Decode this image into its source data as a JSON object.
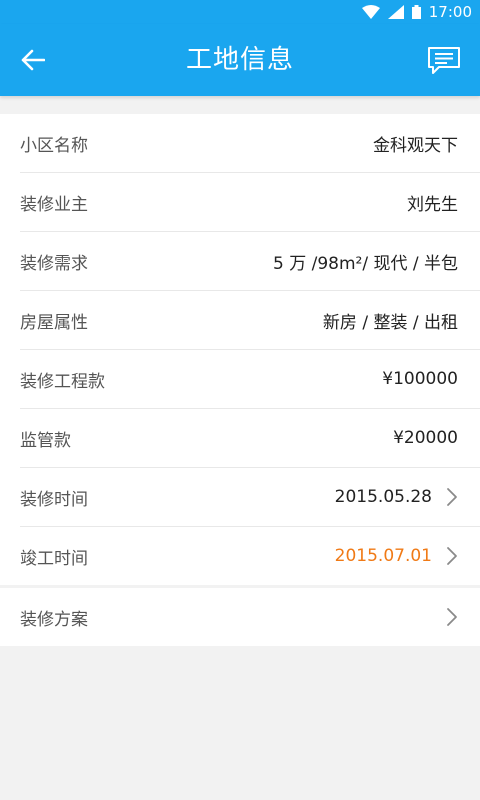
{
  "status": {
    "time": "17:00"
  },
  "appbar": {
    "title": "工地信息"
  },
  "rows": [
    {
      "label": "小区名称",
      "value": "金科观天下"
    },
    {
      "label": "装修业主",
      "value": "刘先生"
    },
    {
      "label": "装修需求",
      "value": "5 万 /98m²/ 现代 / 半包"
    },
    {
      "label": "房屋属性",
      "value": "新房 / 整装 / 出租"
    },
    {
      "label": "装修工程款",
      "value": "¥100000"
    },
    {
      "label": "监管款",
      "value": "¥20000"
    },
    {
      "label": "装修时间",
      "value": "2015.05.28"
    },
    {
      "label": "竣工时间",
      "value": "2015.07.01"
    }
  ],
  "plan": {
    "label": "装修方案"
  },
  "colors": {
    "primary": "#1aa6ef",
    "highlight": "#f07a16"
  }
}
